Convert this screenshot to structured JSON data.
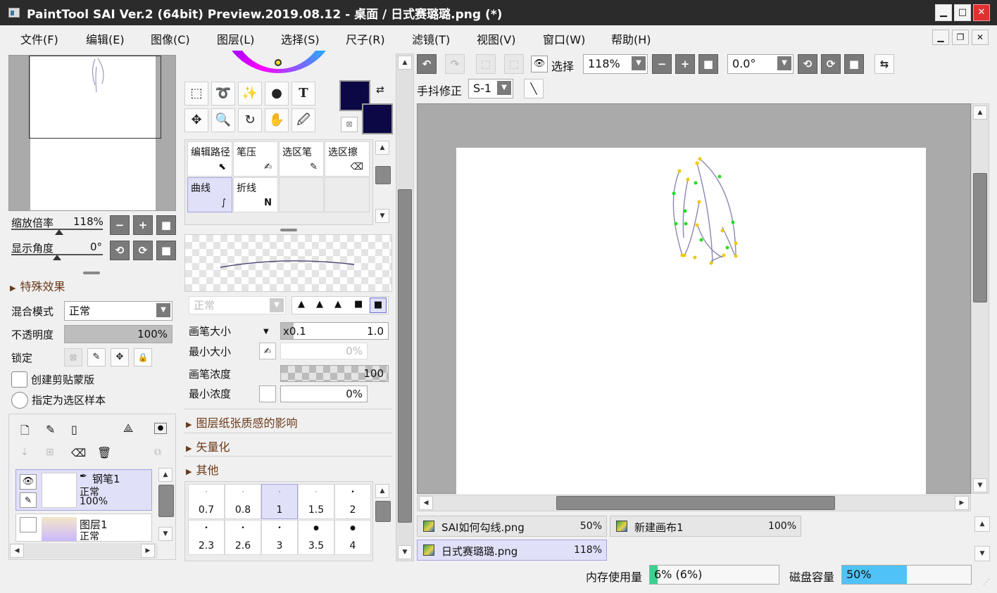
{
  "window": {
    "title": "PaintTool SAI Ver.2 (64bit) Preview.2019.08.12 - 桌面 / 日式赛璐璐.png (*)"
  },
  "menu": [
    "文件(F)",
    "编辑(E)",
    "图像(C)",
    "图层(L)",
    "选择(S)",
    "尺子(R)",
    "滤镜(T)",
    "视图(V)",
    "窗口(W)",
    "帮助(H)"
  ],
  "navigator": {
    "zoom_label": "缩放倍率",
    "zoom_value": "118%",
    "angle_label": "显示角度",
    "angle_value": "0°"
  },
  "layer_props": {
    "effects_section": "特殊效果",
    "blend_label": "混合模式",
    "blend_value": "正常",
    "opacity_label": "不透明度",
    "opacity_value": "100%",
    "opacity_fraction": 1.0,
    "lock_label": "锁定",
    "clip_label": "创建剪贴蒙版",
    "sample_label": "指定为选区样本"
  },
  "layers": [
    {
      "name": "钢笔1",
      "mode": "正常",
      "opacity": "100%",
      "selected": true,
      "visible": true
    },
    {
      "name": "图层1",
      "mode": "正常",
      "opacity": "",
      "selected": false,
      "visible": false
    }
  ],
  "tools": {
    "text_tool": "T",
    "primary_color": "#0c0845",
    "secondary_color": "#0c0845"
  },
  "brush_tools": [
    {
      "label": "编辑路径",
      "icon": "path-edit-icon",
      "selected": false
    },
    {
      "label": "笔压",
      "icon": "pressure-icon",
      "selected": false
    },
    {
      "label": "选区笔",
      "icon": "selection-pen-icon",
      "selected": false
    },
    {
      "label": "选区擦",
      "icon": "selection-eraser-icon",
      "selected": false
    },
    {
      "label": "曲线",
      "icon": "curve-icon",
      "selected": true
    },
    {
      "label": "折线",
      "icon": "polyline-icon",
      "selected": false
    }
  ],
  "brush_settings": {
    "mode_value": "正常",
    "size_label": "画笔大小",
    "size_multiplier": "x0.1",
    "size_value": "1.0",
    "min_size_label": "最小大小",
    "min_size_value": "0%",
    "density_label": "画笔浓度",
    "density_value": "100",
    "min_density_label": "最小浓度",
    "min_density_value": "0%",
    "section_paper": "图层纸张质感的影响",
    "section_vector": "矢量化",
    "section_other": "其他"
  },
  "brush_sizes": [
    {
      "value": "0.7",
      "selected": false
    },
    {
      "value": "0.8",
      "selected": false
    },
    {
      "value": "1",
      "selected": true
    },
    {
      "value": "1.5",
      "selected": false
    },
    {
      "value": "2",
      "selected": false
    },
    {
      "value": "2.3",
      "selected": false
    },
    {
      "value": "2.6",
      "selected": false
    },
    {
      "value": "3",
      "selected": false
    },
    {
      "value": "3.5",
      "selected": false
    },
    {
      "value": "4",
      "selected": false
    }
  ],
  "toolbar": {
    "select_label": "选择",
    "zoom_value": "118%",
    "angle_value": "0.0°",
    "stabilizer_label": "手抖修正",
    "stabilizer_value": "S-1"
  },
  "documents": [
    {
      "name": "SAI如何勾线.png",
      "zoom": "50%",
      "selected": false
    },
    {
      "name": "新建画布1",
      "zoom": "100%",
      "selected": false
    },
    {
      "name": "日式赛璐璐.png",
      "zoom": "118%",
      "selected": true
    }
  ],
  "status": {
    "memory_label": "内存使用量",
    "memory_value": "6% (6%)",
    "memory_fraction": 0.06,
    "disk_label": "磁盘容量",
    "disk_value": "50%",
    "disk_fraction": 0.5
  },
  "colors": {
    "accent_selected": "#e0e0f8",
    "path_stroke": "#8a87b0",
    "anchor_green": "#22dd22",
    "anchor_yellow": "#f0c800",
    "disk_bar": "#4fc3f7",
    "memory_bar": "#3ecf8e"
  }
}
